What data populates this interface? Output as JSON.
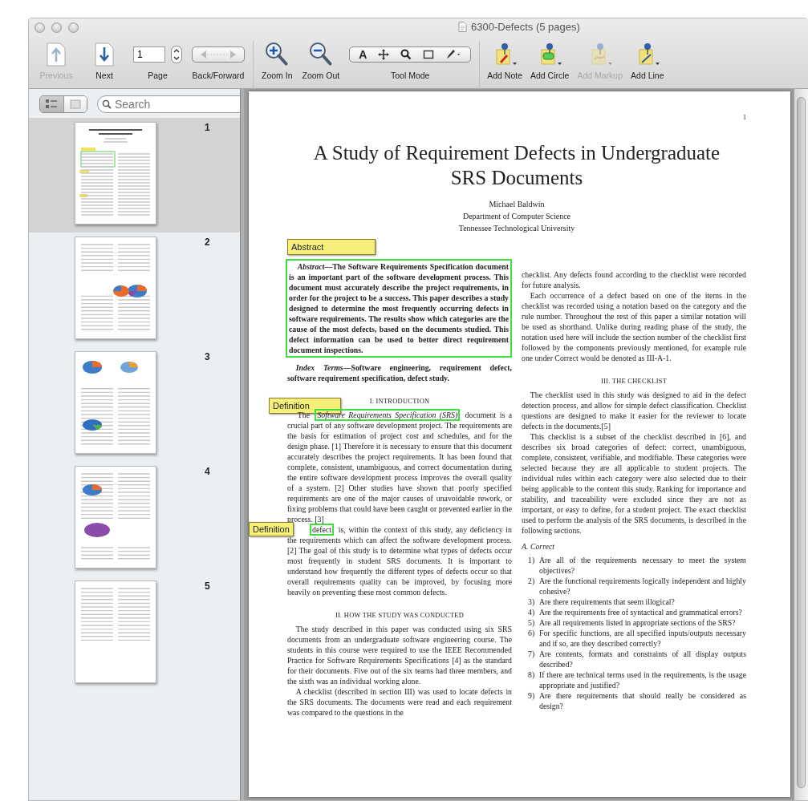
{
  "window": {
    "title": "6300-Defects (5 pages)"
  },
  "toolbar": {
    "items": [
      {
        "kind": "previous",
        "label": "Previous",
        "disabled": true
      },
      {
        "kind": "next",
        "label": "Next",
        "disabled": false
      },
      {
        "kind": "page",
        "label": "Page",
        "value": "1",
        "disabled": false
      },
      {
        "kind": "back_forward",
        "label": "Back/Forward",
        "disabled": false
      },
      {
        "kind": "zoom_in",
        "label": "Zoom In",
        "disabled": false
      },
      {
        "kind": "zoom_out",
        "label": "Zoom Out",
        "disabled": false
      },
      {
        "kind": "tool_mode",
        "label": "Tool Mode",
        "text_tool": "A",
        "disabled": false
      },
      {
        "kind": "add_note",
        "label": "Add Note",
        "disabled": false
      },
      {
        "kind": "add_circle",
        "label": "Add Circle",
        "disabled": false
      },
      {
        "kind": "add_markup",
        "label": "Add Markup",
        "disabled": true
      },
      {
        "kind": "add_line",
        "label": "Add Line",
        "disabled": false
      }
    ]
  },
  "sidebar": {
    "view_modes": [
      {
        "kind": "list",
        "selected": true
      },
      {
        "kind": "grid",
        "selected": false
      }
    ],
    "search": {
      "placeholder": "Search"
    },
    "thumbnails": [
      {
        "number": "1",
        "selected": true
      },
      {
        "number": "2",
        "selected": false
      },
      {
        "number": "3",
        "selected": false
      },
      {
        "number": "4",
        "selected": false
      },
      {
        "number": "5",
        "selected": false
      }
    ]
  },
  "document": {
    "page_number": "1",
    "title": "A Study of Requirement Defects in Undergraduate SRS Documents",
    "authors": [
      "Michael Baldwin",
      "Department of Computer Science",
      "Tennessee Technological University"
    ],
    "columns": [
      [
        {
          "kind": "abstract",
          "note": "Abstract",
          "highlighted": true,
          "text": "*Abstract*—The Software Requirements Specification document is an important part of the software development process. This document must accurately describe the project requirements, in order for the project to be a success. This paper describes a study designed to determine the most frequently occurring defects in software requirements. The results show which categories are the cause of the most defects, based on the documents studied. This defect information can be used to better direct requirement document inspections."
        },
        {
          "kind": "index_terms",
          "text": "*Index Terms*—Software engineering, requirement defect, software requirement specification, defect study."
        },
        {
          "kind": "heading",
          "note": "Definition",
          "text": "I. INTRODUCTION"
        },
        {
          "kind": "paragraph",
          "highlighted": false,
          "parts": [
            {
              "text": "The",
              "highlighted": false
            },
            {
              "text": "*Software Requirements Specification (SRS)*",
              "highlighted": true
            },
            {
              "text": "document is a crucial part of any software development project. The requirements are the basis for estimation of project cost and schedules, and for the design phase. [1] Therefore it is necessary to ensure that this document accurately describes the project requirements. It has been found that complete, consistent, unambiguous, and correct documentation during the entire software development process improves the overall quality of a system. [2] Other studies have shown that poorly specified requirements are one of the major causes of unavoidable rework, or fixing problems that could have been caught or prevented earlier in the process. [3]",
              "highlighted": false
            }
          ]
        },
        {
          "kind": "paragraph",
          "note": "Definition",
          "highlighted": false,
          "parts": [
            {
              "text": "defect",
              "highlighted": true
            },
            {
              "text": "is, within the context of this study, any deficiency in the requirements which can affect the software development process. [2] The goal of this study is to determine what types of defects occur most frequently in student SRS documents. It is important to understand how frequently the different types of defects occur so that overall requirements quality can be improved, by focusing more heavily on preventing these most common defects.",
              "highlighted": false
            }
          ]
        },
        {
          "kind": "heading",
          "text": "II. HOW THE STUDY WAS CONDUCTED"
        },
        {
          "kind": "paragraph",
          "highlighted": false,
          "text": "The study described in this paper was conducted using six SRS documents from an undergraduate software engineering course. The students in this course were required to use the IEEE Recommended Practice for Software Requirements Specifications [4] as the standard for their documents. Five out of the six teams had three members, and the sixth was an individual working alone."
        },
        {
          "kind": "paragraph",
          "highlighted": false,
          "text": "A checklist (described in section III) was used to locate defects in the SRS documents. The documents were read and each requirement was compared to the questions in the"
        }
      ],
      [
        {
          "kind": "continuation",
          "text": "checklist. Any defects found according to the checklist were recorded for future analysis."
        },
        {
          "kind": "paragraph",
          "highlighted": false,
          "text": "Each occurrence of a defect based on one of the items in the checklist was recorded using a notation based on the category and the rule number. Throughout the rest of this paper a similar notation will be used as shorthand. Unlike during reading phase of the study, the notation used here will include the section number of the checklist first followed by the components previously mentioned, for example rule one under Correct would be denoted as III-A-1."
        },
        {
          "kind": "heading",
          "text": "III. THE CHECKLIST"
        },
        {
          "kind": "paragraph",
          "highlighted": false,
          "text": "The checklist used in this study was designed to aid in the defect detection process, and allow for simple defect classification. Checklist questions are designed to make it easier for the reviewer to locate defects in the documents.[5]"
        },
        {
          "kind": "paragraph",
          "highlighted": false,
          "text": "This checklist is a subset of the checklist described in [6], and describes six broad categories of defect: correct, unambiguous, complete, consistent, verifiable, and modifiable. These categories were selected because they are all applicable to student projects. The individual rules within each category were also selected due to their being applicable to the content this study. Ranking for importance and stability, and traceability were excluded since they are not as important, or easy to define, for a student project. The exact checklist used to perform the analysis of the SRS documents, is described in the following sections."
        },
        {
          "kind": "subheading",
          "text": "A. Correct"
        },
        {
          "kind": "list_item",
          "number": "1)",
          "text": "Are all of the requirements necessary to meet the system objectives?"
        },
        {
          "kind": "list_item",
          "number": "2)",
          "text": "Are the functional requirements logically independent and highly cohesive?"
        },
        {
          "kind": "list_item",
          "number": "3)",
          "text": "Are there requirements that seem illogical?"
        },
        {
          "kind": "list_item",
          "number": "4)",
          "text": "Are the requirements free of syntactical and grammatical errors?"
        },
        {
          "kind": "list_item",
          "number": "5)",
          "text": "Are all requirements listed in appropriate sections of the SRS?"
        },
        {
          "kind": "list_item",
          "number": "6)",
          "text": "For specific functions, are all specified inputs/outputs necessary and if so, are they described correctly?"
        },
        {
          "kind": "list_item",
          "number": "7)",
          "text": "Are contents, formats and constraints of all display outputs described?"
        },
        {
          "kind": "list_item",
          "number": "8)",
          "text": "If there are technical terms used in the requirements, is the usage appropriate and justified?"
        },
        {
          "kind": "list_item",
          "number": "9)",
          "text": "Are there requirements that should really be considered as design?"
        }
      ]
    ]
  }
}
